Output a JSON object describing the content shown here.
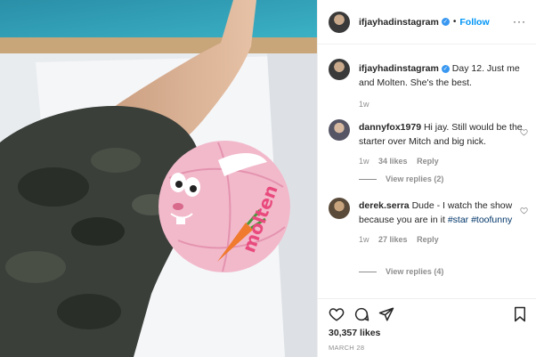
{
  "photo": {
    "ball_brand": "molten",
    "description_icon": "photo-image"
  },
  "header": {
    "username": "ifjayhadinstagram",
    "verified_icon": "verified-badge-icon",
    "separator": "•",
    "follow_label": "Follow",
    "more_label": "···"
  },
  "caption": {
    "username": "ifjayhadinstagram",
    "text": "Day 12. Just me and Molten. She's the best.",
    "time": "1w"
  },
  "comments": [
    {
      "username": "dannyfox1979",
      "text": "Hi jay. Still would be the starter over Mitch and big nick.",
      "time": "1w",
      "likes": "34 likes",
      "reply": "Reply",
      "view_replies": "View replies (2)"
    },
    {
      "username": "derek.serra",
      "text_plain": "Dude - I watch the show because you are in it ",
      "tag1": "#star",
      "tag2": "#toofunny",
      "time": "1w",
      "likes": "27 likes",
      "reply": "Reply",
      "view_replies": "View replies (4)"
    }
  ],
  "footer": {
    "likes": "30,357 likes",
    "date": "MARCH 28"
  },
  "colors": {
    "accent": "#0095f6",
    "verified": "#3897f0",
    "muted": "#8e8e8e",
    "text": "#262626"
  }
}
